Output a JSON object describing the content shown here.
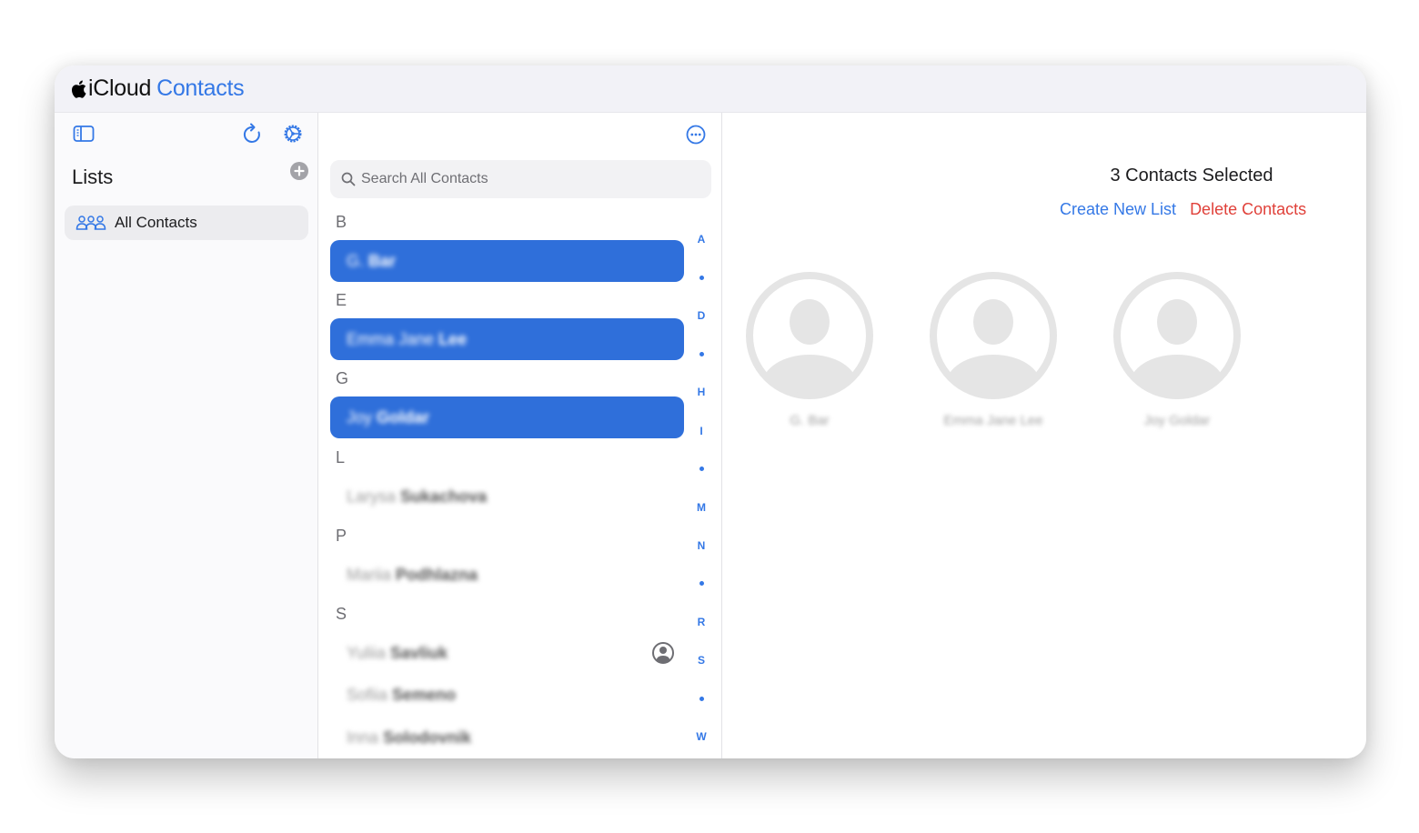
{
  "header": {
    "brand": "iCloud",
    "app_name": "Contacts"
  },
  "sidebar": {
    "title": "Lists",
    "items": [
      {
        "label": "All Contacts",
        "icon": "group-icon",
        "active": true
      }
    ],
    "icons": {
      "toggle": "sidebar-toggle-icon",
      "refresh": "refresh-icon",
      "settings": "settings-icon",
      "add": "add-list-icon"
    }
  },
  "list": {
    "search_placeholder": "Search All Contacts",
    "search_value": "",
    "sections": [
      {
        "letter": "B",
        "contacts": [
          {
            "first": "G.",
            "last": "Bar",
            "selected": true
          }
        ]
      },
      {
        "letter": "E",
        "contacts": [
          {
            "first": "Emma Jane",
            "last": "Lee",
            "selected": true
          }
        ]
      },
      {
        "letter": "G",
        "contacts": [
          {
            "first": "Joy",
            "last": "Goldar",
            "selected": true
          }
        ]
      },
      {
        "letter": "L",
        "contacts": [
          {
            "first": "Larysa",
            "last": "Sukachova",
            "selected": false
          }
        ]
      },
      {
        "letter": "P",
        "contacts": [
          {
            "first": "Mariia",
            "last": "Podhlazna",
            "selected": false
          }
        ]
      },
      {
        "letter": "S",
        "contacts": [
          {
            "first": "Yuliia",
            "last": "Savliuk",
            "selected": false,
            "is_me": true
          },
          {
            "first": "Sofiia",
            "last": "Semeno",
            "selected": false
          },
          {
            "first": "Inna",
            "last": "Solodovnik",
            "selected": false
          }
        ]
      }
    ],
    "index": [
      "A",
      "•",
      "D",
      "•",
      "H",
      "I",
      "•",
      "M",
      "N",
      "•",
      "R",
      "S",
      "•",
      "W"
    ]
  },
  "detail": {
    "title": "3 Contacts Selected",
    "create_list_label": "Create New List",
    "delete_label": "Delete Contacts",
    "selected_cards": [
      {
        "name": "G. Bar"
      },
      {
        "name": "Emma Jane Lee"
      },
      {
        "name": "Joy Goldar"
      }
    ]
  },
  "colors": {
    "accent": "#3478e6",
    "selected_row": "#2f6fda",
    "destructive": "#e0413a",
    "header_bg": "#f2f2f7",
    "sidebar_bg": "#fafafc"
  }
}
